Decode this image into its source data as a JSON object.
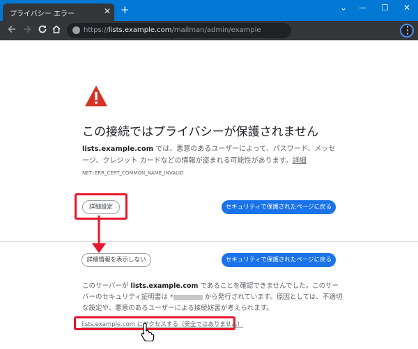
{
  "browser": {
    "tab_title": "プライバシー エラー",
    "tab_close": "✕",
    "new_tab": "+",
    "window_controls": {
      "collapse": "⌄",
      "minimize": "—",
      "maximize": "☐",
      "close": "✕"
    },
    "url_scheme": "https://",
    "url_host": "lists.example.com",
    "url_path": "/mailman/admin/example"
  },
  "page": {
    "title": "この接続ではプライバシーが保護されません",
    "description_host": "lists.example.com",
    "description_text": " では、悪意のあるユーザーによって、パスワード、メッセージ、クレジット カードなどの情報が盗まれる可能性があります。",
    "description_link": "詳細",
    "error_code": "NET::ERR_CERT_COMMON_NAME_INVALID",
    "advanced_button": "詳細設定",
    "back_button": "セキュリティで保護されたページに戻る",
    "hide_details_button": "詳細情報を表示しない",
    "back_button_2": "セキュリティで保護されたページに戻る",
    "detail_prefix": "このサーバーが ",
    "detail_host": "lists.example.com",
    "detail_mid": " であることを確認できませんでした。このサーバーのセキュリティ証明書は *",
    "detail_suffix": " から発行されています。原因としては、不適切な設定や、悪意のあるユーザーによる接続妨害が考えられます。",
    "proceed_link": "lists.example.com にアクセスする（安全ではありません）"
  },
  "colors": {
    "titlebar": "#0078d4",
    "toolbar": "#35363a",
    "primary_button": "#1a73e8",
    "warning_icon": "#d93025",
    "highlight": "#e8162b"
  },
  "icons": [
    "back-arrow-icon",
    "forward-arrow-icon",
    "reload-icon",
    "home-icon",
    "site-info-icon",
    "menu-icon",
    "warning-icon",
    "hand-cursor-icon"
  ]
}
